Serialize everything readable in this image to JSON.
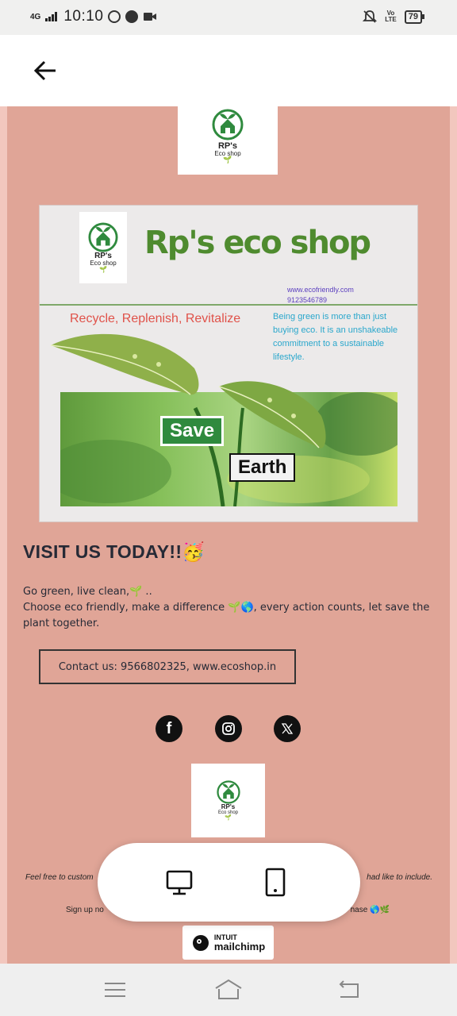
{
  "status_bar": {
    "network": "4G",
    "time": "10:10",
    "volte_top": "Vo",
    "volte_bottom": "LTE",
    "battery": "79"
  },
  "header": {
    "back_icon": "arrow-left-icon"
  },
  "email": {
    "top_logo": {
      "name": "RP's",
      "sub": "Eco shop"
    },
    "banner": {
      "logo": {
        "name": "RP's",
        "sub": "Eco shop"
      },
      "title": "Rp's eco shop",
      "website": "www.ecofriendly.com",
      "phone": "9123546789",
      "slogan": "Recycle, Replenish, Revitalize",
      "description": "Being green is more than just buying eco. It is an unshakeable commitment to a sustainable lifestyle.",
      "save_label": "Save",
      "earth_label": "Earth"
    },
    "visit_title": "VISIT US TODAY!!🥳",
    "body_line1": "Go green, live clean,🌱 ..",
    "body_line2": "Choose eco friendly, make a difference 🌱🌎, every action counts, let save the plant together.",
    "contact_label": "Contact us: 9566802325, www.ecoshop.in",
    "social": [
      {
        "name": "facebook-icon",
        "glyph": "f"
      },
      {
        "name": "instagram-icon",
        "glyph": ""
      },
      {
        "name": "x-icon",
        "glyph": "𝕏"
      }
    ],
    "footer_logo": {
      "name": "RP's",
      "sub": "Eco shop"
    },
    "footer_note_left": "Feel free to custom",
    "footer_note_right": "had like to include.",
    "footer_sign_left": "Sign up no",
    "footer_sign_right": "hase 🌎🌿",
    "mailchimp_top": "INTUIT",
    "mailchimp_bottom": "mailchimp"
  },
  "preview_toggle": {
    "desktop_icon": "desktop-monitor-icon",
    "mobile_icon": "mobile-phone-icon"
  },
  "nav": {
    "menu_icon": "menu-lines-icon",
    "home_icon": "home-icon",
    "back_icon": "back-return-icon"
  },
  "colors": {
    "email_background": "#e0a597",
    "banner_title_green": "#4f8b2f",
    "slogan_red": "#e0524a",
    "description_blue": "#2aa7cc"
  }
}
